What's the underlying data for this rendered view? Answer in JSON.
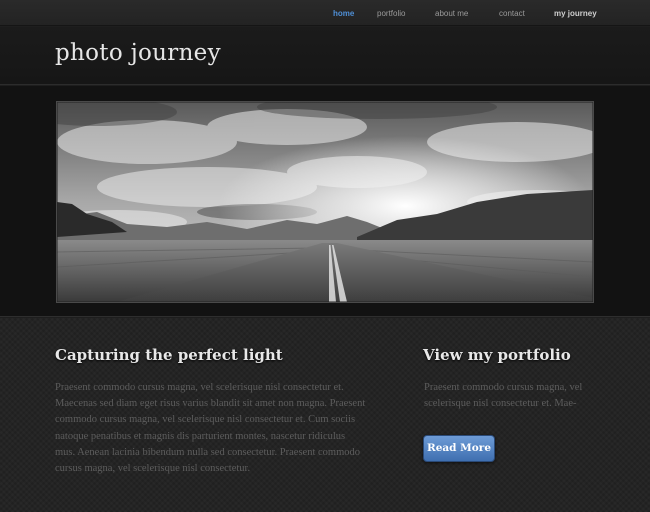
{
  "nav": {
    "items": [
      {
        "label": "home"
      },
      {
        "label": "portfolio"
      },
      {
        "label": "about me"
      },
      {
        "label": "contact"
      },
      {
        "label": "my journey"
      }
    ]
  },
  "header": {
    "title": "photo journey"
  },
  "main": {
    "left": {
      "heading": "Capturing the perfect light",
      "lines": [
        "Praesent commodo cursus magna, vel scelerisque nisl consectetur et.",
        "Maecenas sed diam eget risus varius blandit sit amet non magna. Praesent",
        "commodo cursus magna, vel scelerisque nisl consectetur et. Cum sociis",
        "natoque penatibus et magnis dis parturient montes, nascetur ridiculus",
        "mus. Aenean lacinia bibendum nulla sed consectetur. Praesent commodo",
        "cursus magna, vel scelerisque nisl consectetur."
      ]
    },
    "right": {
      "heading": "View my portfolio",
      "lines": [
        "Praesent commodo cursus magna, vel",
        "scelerisque nisl consectetur et. Mae-"
      ],
      "button_label": "Read More"
    }
  },
  "colors": {
    "accent": "#4f8fd6",
    "button": "#4a7bbf",
    "background": "#1e1e1e"
  }
}
